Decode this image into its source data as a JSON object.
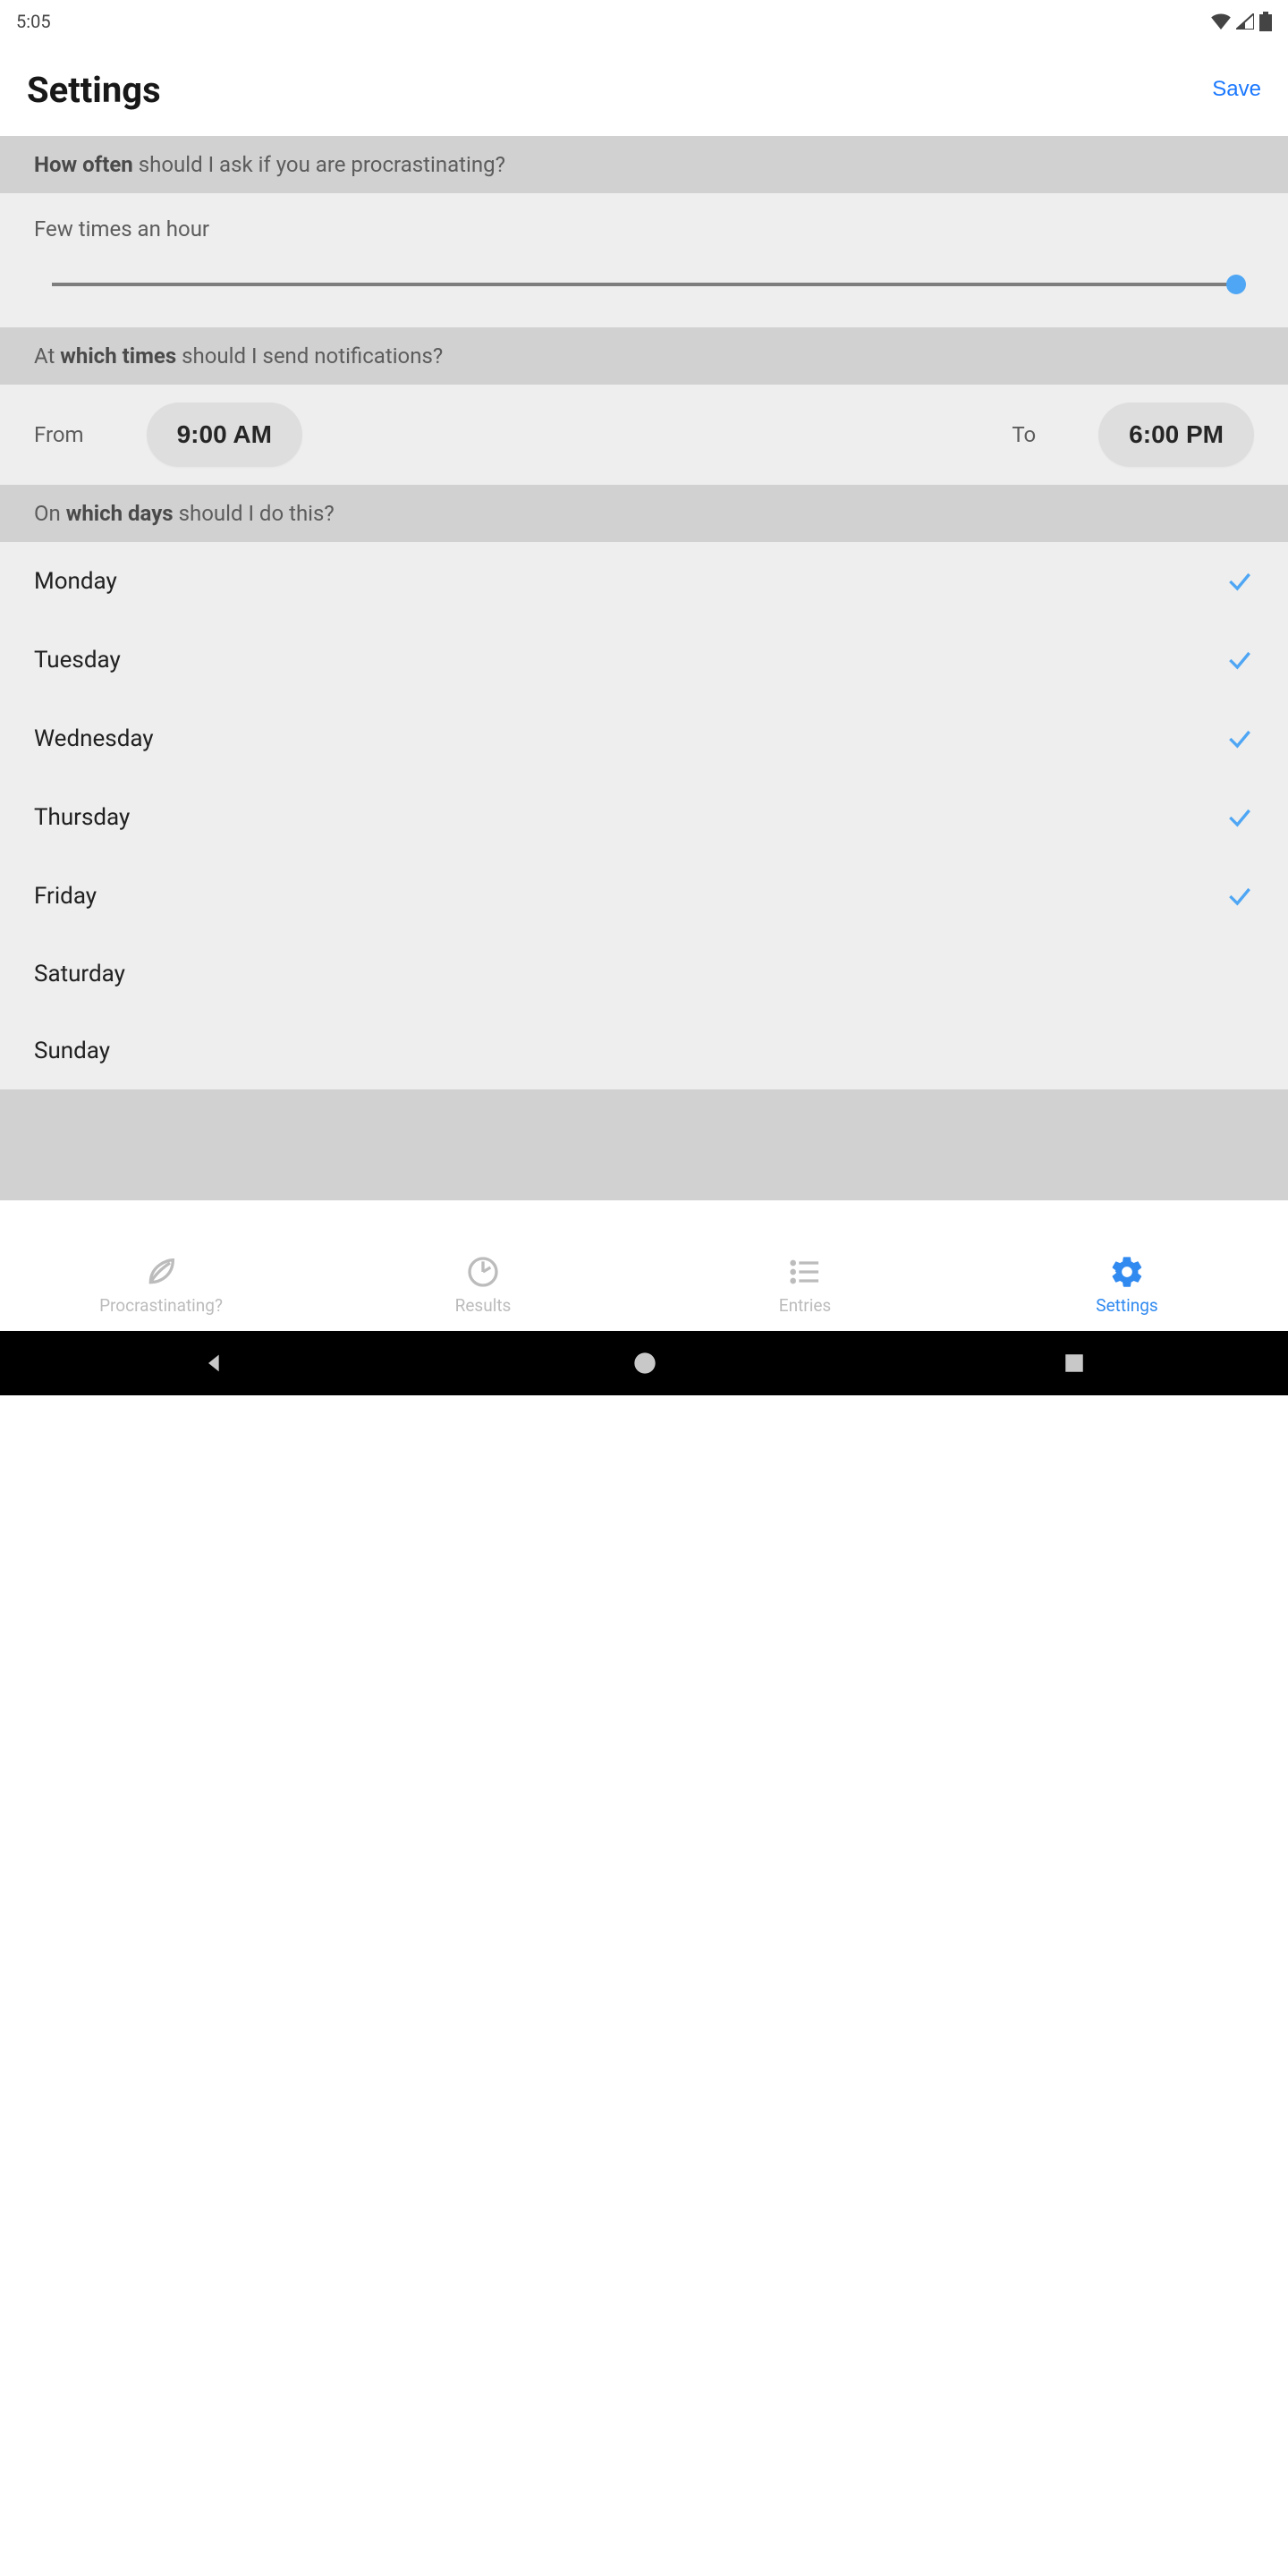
{
  "status": {
    "time": "5:05"
  },
  "header": {
    "title": "Settings",
    "save_label": "Save"
  },
  "sections": {
    "frequency": {
      "question_prefix": "How often",
      "question_rest": " should I ask if you are procrastinating?",
      "value_label": "Few times an hour",
      "slider_percent": 100
    },
    "times": {
      "question_prefix_a": "At ",
      "question_bold": "which times",
      "question_rest": " should I send notifications?",
      "from_label": "From",
      "from_value": "9:00 AM",
      "to_label": "To",
      "to_value": "6:00 PM"
    },
    "days": {
      "question_prefix": "On ",
      "question_bold": "which days",
      "question_rest": " should I do this?",
      "items": [
        {
          "label": "Monday",
          "checked": true
        },
        {
          "label": "Tuesday",
          "checked": true
        },
        {
          "label": "Wednesday",
          "checked": true
        },
        {
          "label": "Thursday",
          "checked": true
        },
        {
          "label": "Friday",
          "checked": true
        },
        {
          "label": "Saturday",
          "checked": false
        },
        {
          "label": "Sunday",
          "checked": false
        }
      ]
    }
  },
  "tabs": [
    {
      "label": "Procrastinating?",
      "icon": "leaf-icon",
      "active": false
    },
    {
      "label": "Results",
      "icon": "clock-icon",
      "active": false
    },
    {
      "label": "Entries",
      "icon": "list-icon",
      "active": false
    },
    {
      "label": "Settings",
      "icon": "gear-icon",
      "active": true
    }
  ],
  "colors": {
    "accent": "#308af0",
    "slider": "#4ea6f4"
  }
}
